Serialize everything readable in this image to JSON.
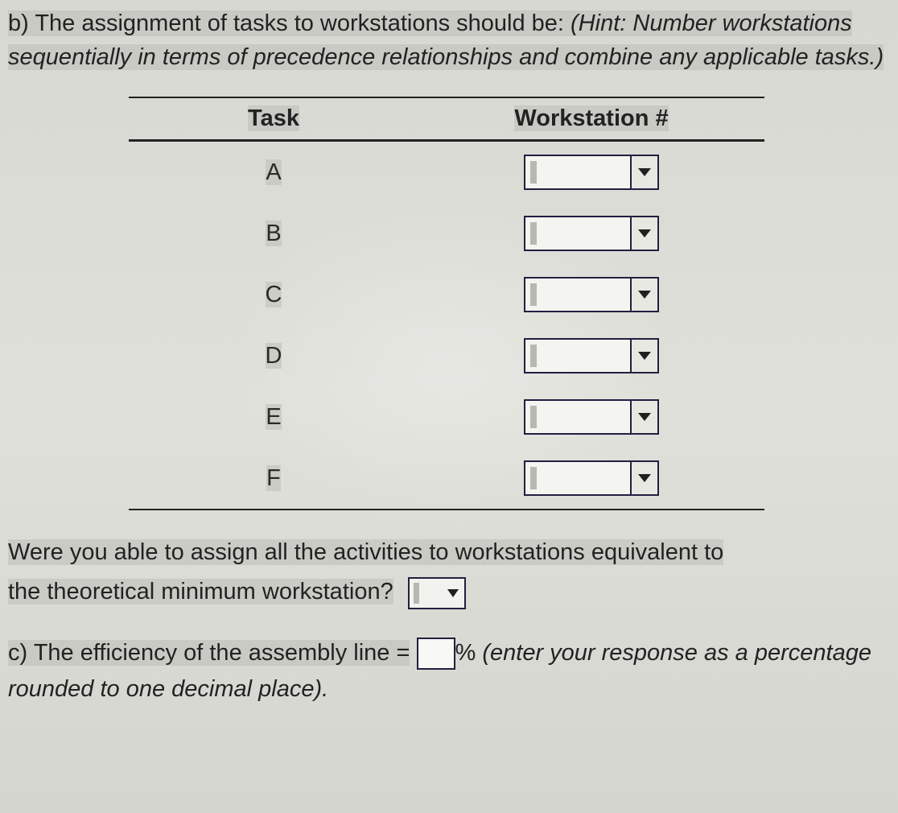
{
  "partB": {
    "leadPlain": "b) The assignment of tasks to workstations should be: ",
    "hintItalic": "(Hint: Number workstations sequentially in terms of precedence relationships and combine any applicable tasks.)"
  },
  "table": {
    "headers": {
      "task": "Task",
      "workstation": "Workstation #"
    },
    "rows": [
      {
        "task": "A",
        "workstation": ""
      },
      {
        "task": "B",
        "workstation": ""
      },
      {
        "task": "C",
        "workstation": ""
      },
      {
        "task": "D",
        "workstation": ""
      },
      {
        "task": "E",
        "workstation": ""
      },
      {
        "task": "F",
        "workstation": ""
      }
    ]
  },
  "questionMid": {
    "line1": "Were you able to assign all the activities to workstations equivalent to",
    "line2": "the theoretical minimum workstation?",
    "answer": ""
  },
  "partC": {
    "lead": "c) The efficiency of the assembly line =",
    "value": "",
    "afterBox": "% ",
    "tailItalic": "(enter your response as a percentage rounded to one decimal place)."
  }
}
